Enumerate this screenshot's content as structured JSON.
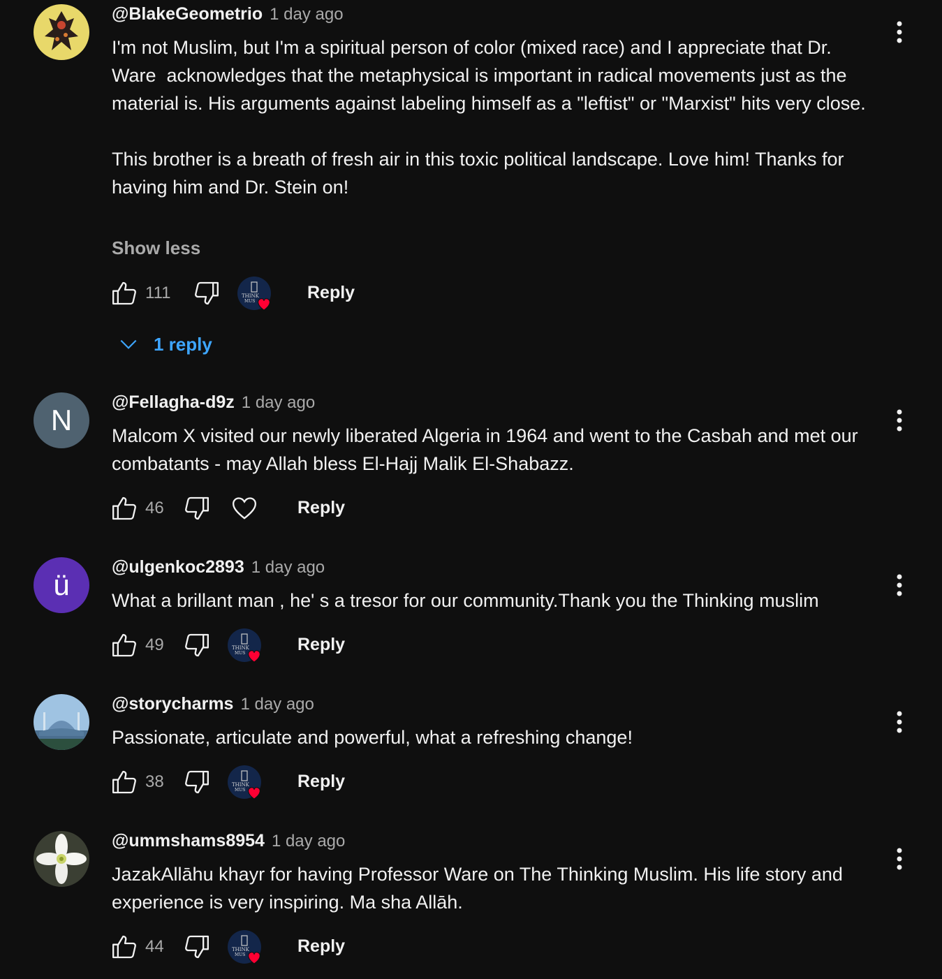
{
  "comments": [
    {
      "author": "@BlakeGeometrio",
      "time": "1 day ago",
      "text": "I'm not Muslim, but I'm a spiritual person of color (mixed race) and I appreciate that Dr. Ware  acknowledges that the metaphysical is important in radical movements just as the material is. His arguments against labeling himself as a \"leftist\" or \"Marxist\" hits very close.\n\nThis brother is a breath of fresh air in this toxic political landscape. Love him! Thanks for having him and Dr. Stein on!",
      "show_less": "Show less",
      "likes": "111",
      "reply_label": "Reply",
      "replies_label": "1 reply",
      "creator_heart": true,
      "avatar": "illustrated-figure-avatar"
    },
    {
      "author": "@Fellagha-d9z",
      "time": "1 day ago",
      "text": "Malcom X visited our newly liberated Algeria in 1964 and went to the Casbah and met our combatants - may Allah bless El-Hajj Malik El-Shabazz.",
      "likes": "46",
      "reply_label": "Reply",
      "creator_heart": false,
      "avatar_letter": "N"
    },
    {
      "author": "@ulgenkoc2893",
      "time": "1 day ago",
      "text": "What a brillant man , he' s a tresor for our community.Thank you the Thinking muslim",
      "likes": "49",
      "reply_label": "Reply",
      "creator_heart": true,
      "avatar_letter": "ü"
    },
    {
      "author": "@storycharms",
      "time": "1 day ago",
      "text": "Passionate, articulate and powerful, what a refreshing change!",
      "likes": "38",
      "reply_label": "Reply",
      "creator_heart": true,
      "avatar": "mosque-photo-avatar"
    },
    {
      "author": "@ummshams8954",
      "time": "1 day ago",
      "text": "JazakAllāhu khayr for having Professor Ware on The Thinking Muslim. His life story and experience is very inspiring. Ma sha Allāh.",
      "likes": "44",
      "reply_label": "Reply",
      "creator_heart": true,
      "avatar": "white-flower-avatar"
    }
  ],
  "colors": {
    "background": "#0f0f0f",
    "primary_text": "#f1f1f1",
    "secondary_text": "#aaaaaa",
    "link_blue": "#3ea6ff",
    "heart_red": "#ff0033"
  },
  "channel_badge_text": [
    "THINK",
    "MUS"
  ]
}
